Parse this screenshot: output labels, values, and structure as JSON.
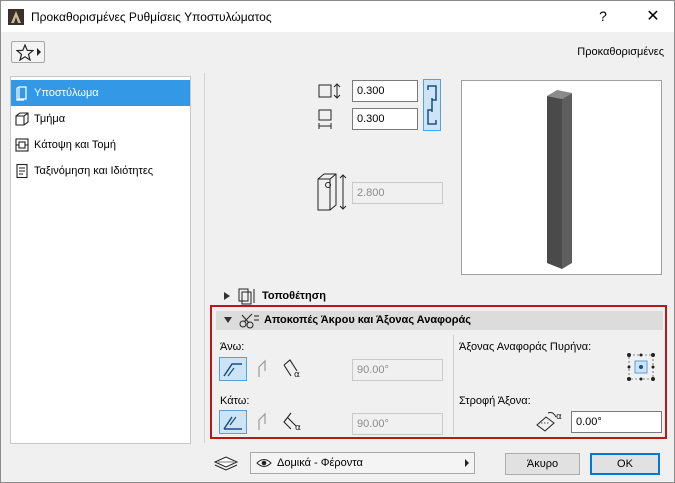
{
  "window": {
    "title": "Προκαθορισμένες Ρυθμίσεις Υποστυλώματος",
    "help_glyph": "?",
    "close_glyph": "✕"
  },
  "toolbar": {
    "favorites_icon": "star-icon",
    "preset_label": "Προκαθορισμένες"
  },
  "sidebar": {
    "items": [
      {
        "label": "Υποστύλωμα",
        "icon": "column-icon",
        "selected": true
      },
      {
        "label": "Τμήμα",
        "icon": "segment-cube-icon",
        "selected": false
      },
      {
        "label": "Κάτοψη και Τομή",
        "icon": "floor-plan-icon",
        "selected": false
      },
      {
        "label": "Ταξινόμηση και Ιδιότητες",
        "icon": "classification-icon",
        "selected": false
      }
    ]
  },
  "dimensions": {
    "width_value": "0.300",
    "depth_value": "0.300",
    "height_value": "2.800"
  },
  "sections": {
    "placement": {
      "label": "Τοποθέτηση",
      "expanded": false
    },
    "end_cuts": {
      "label": "Αποκοπές Άκρου και Άξονας Αναφοράς",
      "expanded": true
    }
  },
  "end_cuts": {
    "top_label": "Άνω:",
    "top_angle": "90.00°",
    "bottom_label": "Κάτω:",
    "bottom_angle": "90.00°",
    "core_anchor_label": "Άξονας Αναφοράς Πυρήνα:",
    "axis_rotation_label": "Στροφή Άξονα:",
    "axis_rotation_value": "0.00°"
  },
  "footer": {
    "layer_value": "Δομικά - Φέροντα",
    "cancel_label": "Άκυρο",
    "ok_label": "OK"
  },
  "colors": {
    "selection": "#3399e6",
    "highlight_border": "#b81818",
    "toggle_on": "#cde4f7",
    "default_button_border": "#0078d7"
  }
}
